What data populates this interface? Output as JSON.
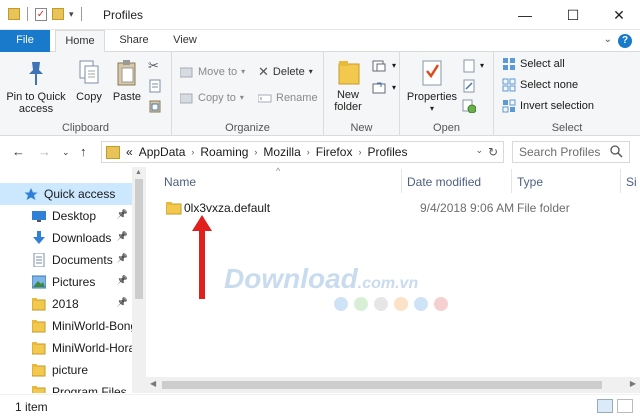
{
  "window": {
    "title": "Profiles",
    "minimize": "—",
    "maximize": "☐",
    "close": "✕"
  },
  "ribbon_tabs": [
    "File",
    "Home",
    "Share",
    "View"
  ],
  "ribbon": {
    "clipboard": {
      "label": "Clipboard",
      "pin": "Pin to Quick access",
      "copy": "Copy",
      "paste": "Paste"
    },
    "organize": {
      "label": "Organize",
      "move_to": "Move to",
      "copy_to": "Copy to",
      "delete": "Delete",
      "rename": "Rename"
    },
    "new": {
      "label": "New",
      "new_folder": "New folder"
    },
    "open": {
      "label": "Open",
      "properties": "Properties"
    },
    "select": {
      "label": "Select",
      "select_all": "Select all",
      "select_none": "Select none",
      "invert": "Invert selection"
    }
  },
  "address": {
    "prefix": "«",
    "crumbs": [
      "AppData",
      "Roaming",
      "Mozilla",
      "Firefox",
      "Profiles"
    ],
    "search_placeholder": "Search Profiles"
  },
  "nav_pane": {
    "items": [
      {
        "label": "Quick access",
        "icon": "star-icon",
        "selected": true,
        "pinned": false
      },
      {
        "label": "Desktop",
        "icon": "desktop-icon",
        "selected": false,
        "pinned": true
      },
      {
        "label": "Downloads",
        "icon": "download-icon",
        "selected": false,
        "pinned": true
      },
      {
        "label": "Documents",
        "icon": "document-icon",
        "selected": false,
        "pinned": true
      },
      {
        "label": "Pictures",
        "icon": "picture-icon",
        "selected": false,
        "pinned": true
      },
      {
        "label": "2018",
        "icon": "folder-icon",
        "selected": false,
        "pinned": true
      },
      {
        "label": "MiniWorld-Bong",
        "icon": "folder-icon",
        "selected": false,
        "pinned": false
      },
      {
        "label": "MiniWorld-Hora",
        "icon": "folder-icon",
        "selected": false,
        "pinned": false
      },
      {
        "label": "picture",
        "icon": "folder-icon",
        "selected": false,
        "pinned": false
      },
      {
        "label": "Program Files",
        "icon": "folder-icon",
        "selected": false,
        "pinned": false
      }
    ]
  },
  "columns": [
    "Name",
    "Date modified",
    "Type",
    "Si"
  ],
  "files": [
    {
      "name": "0lx3vxza.default",
      "date": "9/4/2018 9:06 AM",
      "type": "File folder"
    }
  ],
  "watermark": {
    "main": "Download",
    "suffix": ".com.vn"
  },
  "status": {
    "items": "1 item"
  },
  "colors": {
    "accent": "#1979ca",
    "folder": "#e8c35a",
    "arrow": "#e0201c",
    "selected": "#cce8ff"
  }
}
